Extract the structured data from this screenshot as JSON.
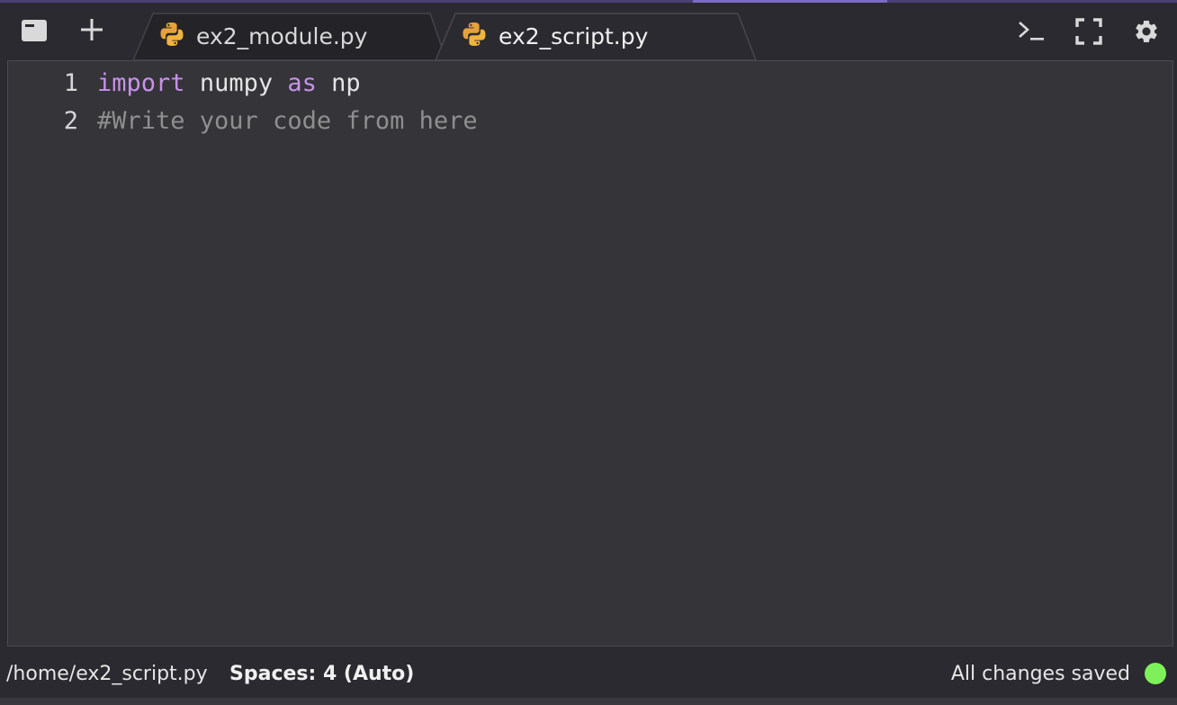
{
  "tabs": [
    {
      "label": "ex2_module.py",
      "active": false,
      "icon": "python-icon"
    },
    {
      "label": "ex2_script.py",
      "active": true,
      "icon": "python-icon"
    }
  ],
  "toolbar": {
    "left_icons": [
      "panel-icon",
      "plus-icon"
    ],
    "right_icons": [
      "terminal-icon",
      "fullscreen-icon",
      "gear-icon"
    ]
  },
  "editor": {
    "lines": [
      {
        "number": "1",
        "tokens": {
          "kw1": "import",
          "id1": "numpy",
          "kw2": "as",
          "id2": "np"
        }
      },
      {
        "number": "2",
        "text": "#Write your code from here"
      }
    ]
  },
  "status": {
    "path": "/home/ex2_script.py",
    "spaces": "Spaces: 4 (Auto)",
    "saved": "All changes saved",
    "saved_color": "#7ef05a"
  },
  "colors": {
    "keyword": "#c792ea",
    "comment": "#8f8f8f",
    "python_blue": "#e5a13a",
    "python_yellow": "#f0b43c"
  }
}
